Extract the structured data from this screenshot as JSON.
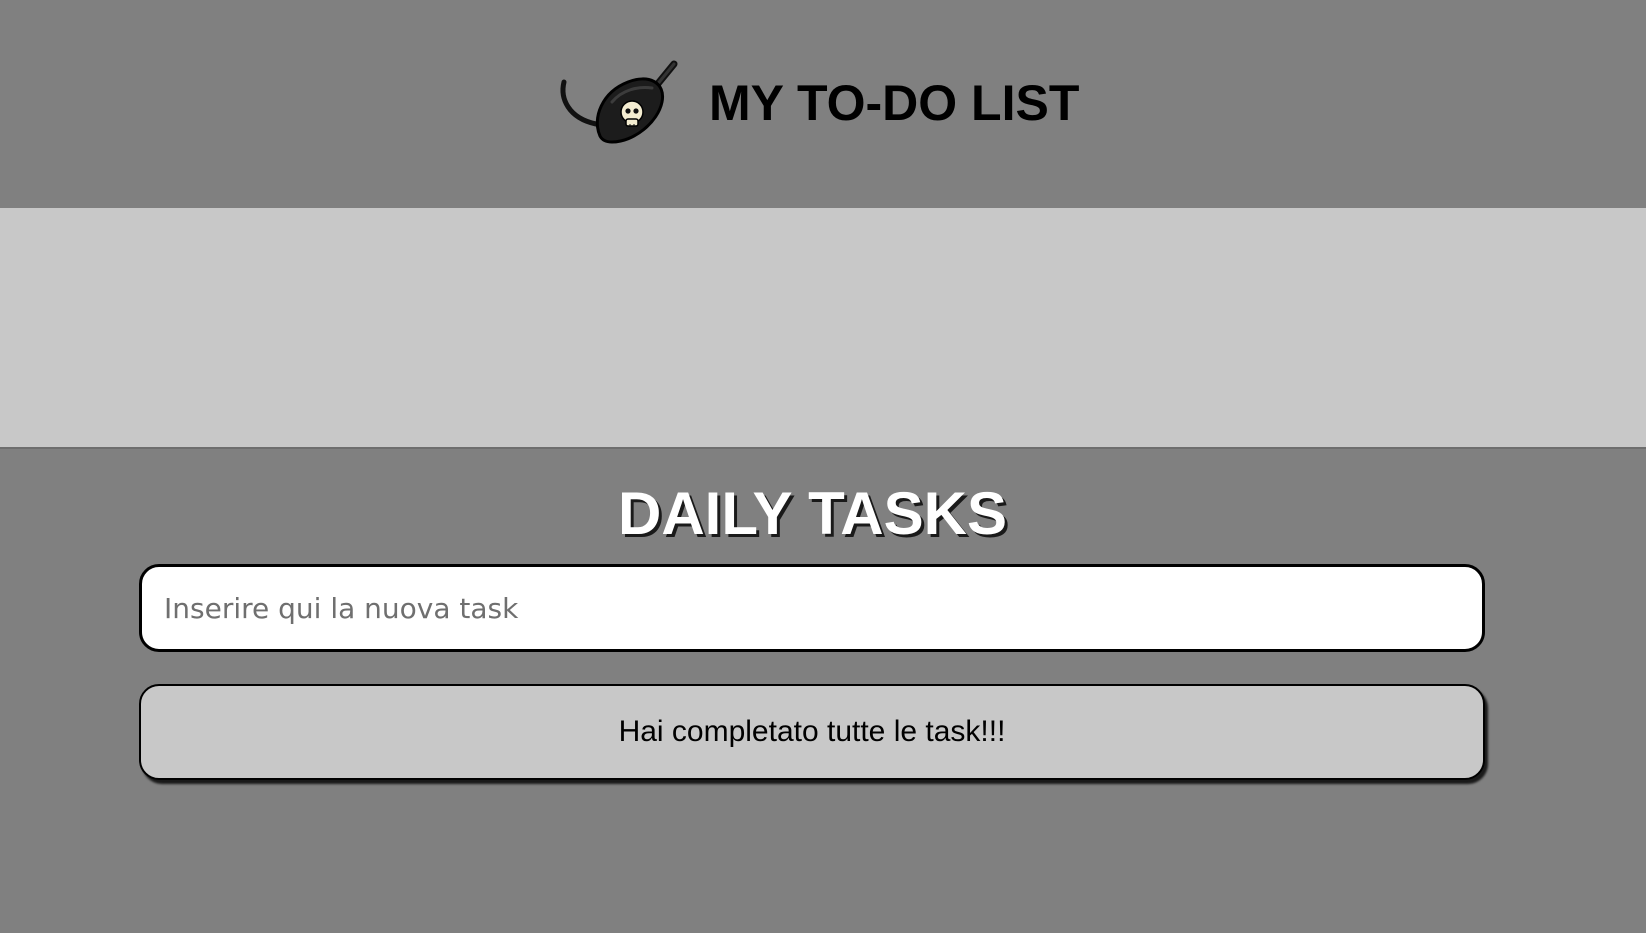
{
  "header": {
    "title": "MY TO-DO LIST",
    "logo_icon": "pirate-eyepatch-icon",
    "background": "#808080"
  },
  "banner": {
    "background": "#c8c8c8"
  },
  "main": {
    "section_title": "DAILY TASKS",
    "new_task_input": {
      "value": "",
      "placeholder": "Inserire qui la nuova task"
    },
    "status_message": "Hai completato tutte le task!!!"
  }
}
